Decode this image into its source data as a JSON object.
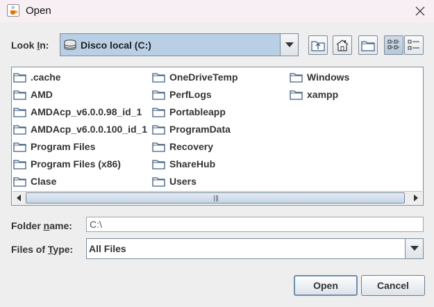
{
  "window": {
    "title": "Open",
    "icon": "java-cup-icon",
    "close_icon": "close-icon"
  },
  "look_in": {
    "label_prefix": "Look ",
    "label_mnemonic": "I",
    "label_suffix": "n:",
    "selected": "Disco local (C:)",
    "drive_icon": "hard-drive-icon"
  },
  "toolbar": {
    "buttons": [
      "up-one-level",
      "home",
      "new-folder",
      "list-view",
      "details-view"
    ],
    "active": "list-view"
  },
  "files": {
    "column1": [
      ".cache",
      "AMD",
      "AMDAcp_v6.0.0.98_id_1",
      "AMDAcp_v6.0.0.100_id_1",
      "Program Files",
      "Program Files (x86)",
      "Clase"
    ],
    "column2": [
      "OneDriveTemp",
      "PerfLogs",
      "Portableapp",
      "ProgramData",
      "Recovery",
      "ShareHub",
      "Users"
    ],
    "column3": [
      "Windows",
      "xampp"
    ]
  },
  "folder_name": {
    "label_prefix": "Folder ",
    "label_mnemonic": "n",
    "label_suffix": "ame:",
    "value": "C:\\"
  },
  "files_of_type": {
    "label_prefix": "Files of ",
    "label_mnemonic": "T",
    "label_suffix": "ype:",
    "selected": "All Files"
  },
  "buttons": {
    "open": "Open",
    "cancel": "Cancel"
  },
  "colors": {
    "title_bar": "#f7eff3",
    "selection": "#b8cfe5",
    "folder_fill": "#ffffff",
    "folder_stroke": "#3d5d80"
  }
}
